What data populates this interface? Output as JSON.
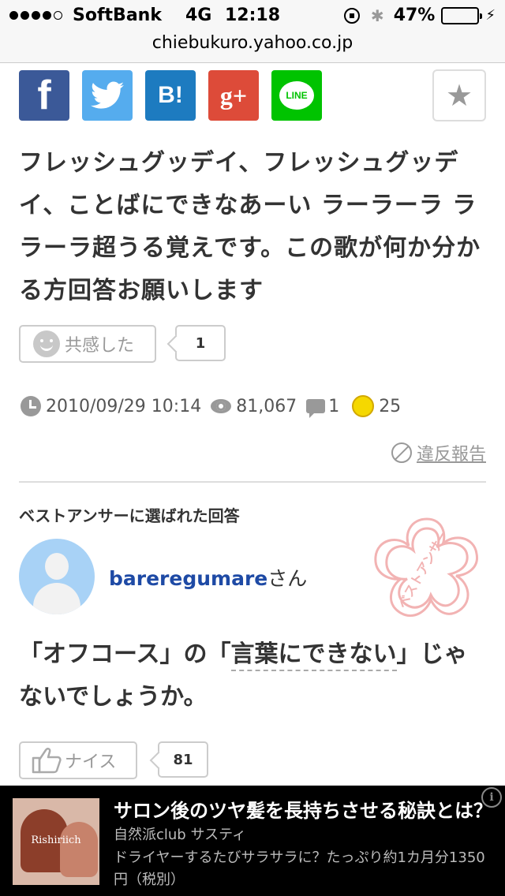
{
  "status_bar": {
    "carrier": "SoftBank",
    "network": "4G",
    "time": "12:18",
    "battery": "47%",
    "battery_level": 0.47
  },
  "browser": {
    "url": "chiebukuro.yahoo.co.jp"
  },
  "share": {
    "facebook_glyph": "f",
    "hatena_glyph": "B!",
    "google_plus_glyph": "g+",
    "line_glyph": "LINE",
    "icons": [
      "facebook-icon",
      "twitter-icon",
      "hatena-bookmark-icon",
      "google-plus-icon",
      "line-icon",
      "star-icon"
    ]
  },
  "question": {
    "text": "フレッシュグッデイ、フレッシュグッデイ、ことばにできなあーい ラーラーラ ララーラ超うる覚えです。この歌が何か分かる方回答お願いします",
    "empathy_label": "共感した",
    "empathy_count": "1",
    "datetime": "2010/09/29 10:14",
    "views": "81,067",
    "answers": "1",
    "coin_glyph": "チ",
    "coins": "25",
    "report_label": "違反報告"
  },
  "best_answer": {
    "heading": "ベストアンサーに選ばれた回答",
    "username": "bareregumare",
    "honorific": "さん",
    "stamp_text": "ベストアンサー",
    "answer_parts": {
      "before": "「オフコース」の「",
      "keyword": "言葉にできない",
      "after": "」じゃないでしょうか。"
    },
    "nice_label": "ナイス",
    "nice_count": "81"
  },
  "ad": {
    "title": "サロン後のツヤ髪を長持ちさせる秘訣とは？",
    "sponsor": "自然派club サスティ",
    "description": "ドライヤーするたびサラサラに？たっぷり約1カ月分1350円（税別）",
    "image_brand": "Rishiriich",
    "info_glyph": "i"
  },
  "colors": {
    "facebook": "#3b5998",
    "twitter": "#55acee",
    "hatena": "#1d7bc0",
    "google_plus": "#dd4b39",
    "line": "#00c300",
    "username": "#1e4aa5",
    "coin": "#f5d800",
    "stamp": "#f2b3b3"
  }
}
